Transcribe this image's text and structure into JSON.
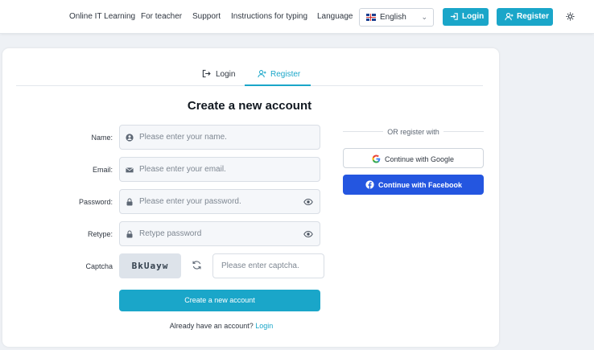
{
  "nav": {
    "links": [
      "Online IT Learning",
      "For teacher",
      "Support",
      "Instructions for typing",
      "Language"
    ],
    "language": {
      "selected": "English",
      "flag_icon": "uk-flag-icon"
    },
    "login_button": "Login",
    "register_button": "Register",
    "theme_icon": "sun-icon"
  },
  "tabs": [
    {
      "label": "Login",
      "icon": "login-icon",
      "active": false
    },
    {
      "label": "Register",
      "icon": "add-user-icon",
      "active": true
    }
  ],
  "form": {
    "title": "Create a new account",
    "name": {
      "label": "Name:",
      "placeholder": "Please enter your name.",
      "value": ""
    },
    "email": {
      "label": "Email:",
      "placeholder": "Please enter your email.",
      "value": ""
    },
    "password": {
      "label": "Password:",
      "placeholder": "Please enter your password.",
      "value": ""
    },
    "retype": {
      "label": "Retype:",
      "placeholder": "Retype password",
      "value": ""
    },
    "captcha": {
      "label": "Captcha",
      "code": "BkUayw",
      "placeholder": "Please enter captcha.",
      "value": ""
    },
    "submit_label": "Create a new account",
    "already_text": "Already have an account?",
    "already_link": "Login"
  },
  "social": {
    "divider_text": "OR register with",
    "google_label": "Continue with Google",
    "facebook_label": "Continue with Facebook"
  },
  "colors": {
    "accent": "#1aa6c9",
    "facebook": "#2456e0",
    "background": "#eef1f5"
  }
}
